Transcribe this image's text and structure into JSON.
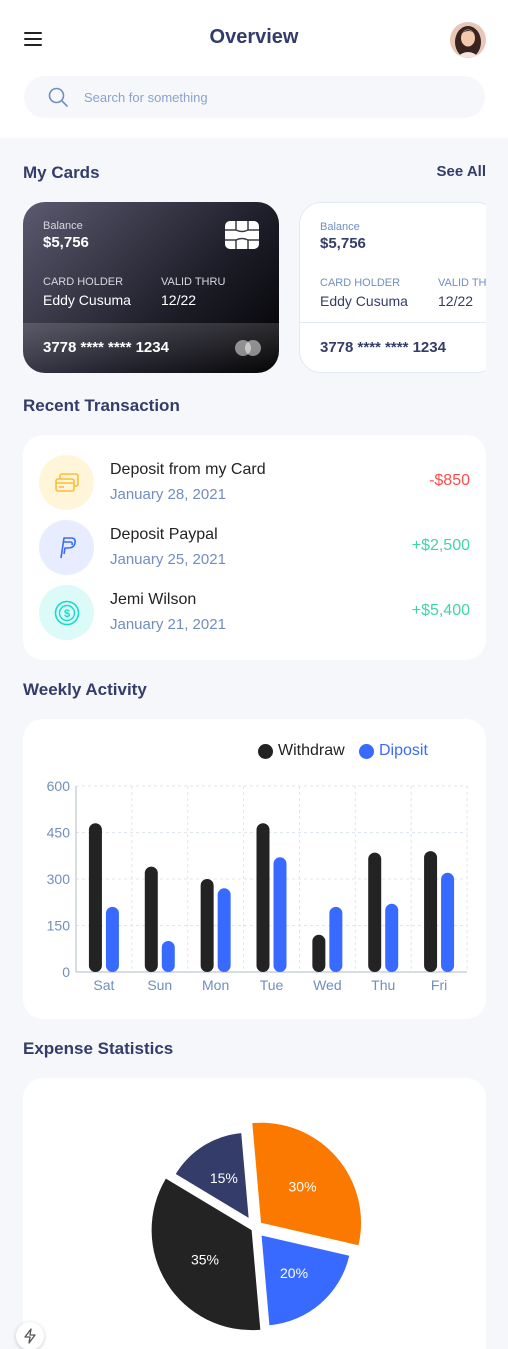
{
  "header": {
    "title": "Overview",
    "search_placeholder": "Search for something"
  },
  "cards_section": {
    "title": "My Cards",
    "see_all": "See All",
    "cards": [
      {
        "theme": "dark",
        "balance_label": "Balance",
        "balance": "$5,756",
        "holder_label": "CARD HOLDER",
        "holder": "Eddy Cusuma",
        "valid_label": "VALID THRU",
        "valid": "12/22",
        "number": "3778 **** **** 1234"
      },
      {
        "theme": "light",
        "balance_label": "Balance",
        "balance": "$5,756",
        "holder_label": "CARD HOLDER",
        "holder": "Eddy Cusuma",
        "valid_label": "VALID THRU",
        "valid": "12/22",
        "number": "3778 **** **** 1234"
      }
    ]
  },
  "transactions": {
    "title": "Recent Transaction",
    "items": [
      {
        "icon": "card-icon",
        "title": "Deposit from my Card",
        "date": "January 28, 2021",
        "amount": "-$850",
        "kind": "neg",
        "icon_bg": "#fff5d9",
        "icon_color": "#ffbb38"
      },
      {
        "icon": "paypal-icon",
        "title": "Deposit Paypal",
        "date": "January 25, 2021",
        "amount": "+$2,500",
        "kind": "pos",
        "icon_bg": "#e7edff",
        "icon_color": "#396aff"
      },
      {
        "icon": "dollar-icon",
        "title": "Jemi Wilson",
        "date": "January 21, 2021",
        "amount": "+$5,400",
        "kind": "pos",
        "icon_bg": "#dcfaf8",
        "icon_color": "#16dbcc"
      }
    ]
  },
  "weekly": {
    "title": "Weekly Activity"
  },
  "expense": {
    "title": "Expense Statistics"
  },
  "colors": {
    "withdraw": "#232323",
    "deposit": "#396aff",
    "orange": "#fc7900",
    "navy": "#343c6a",
    "blue": "#396aff",
    "black": "#232323"
  },
  "chart_data": [
    {
      "type": "bar",
      "categories": [
        "Sat",
        "Sun",
        "Mon",
        "Tue",
        "Wed",
        "Thu",
        "Fri"
      ],
      "series": [
        {
          "name": "Withdraw",
          "values": [
            480,
            340,
            300,
            480,
            120,
            385,
            390
          ]
        },
        {
          "name": "Diposit",
          "values": [
            210,
            100,
            270,
            370,
            210,
            220,
            320
          ]
        }
      ],
      "yticks": [
        0,
        150,
        300,
        450,
        600
      ],
      "ylim": [
        0,
        600
      ],
      "grid": true,
      "legend": "top-right"
    },
    {
      "type": "pie",
      "slices": [
        {
          "label": "30%",
          "value": 30,
          "color": "#fc7900"
        },
        {
          "label": "20%",
          "value": 20,
          "color": "#396aff"
        },
        {
          "label": "35%",
          "value": 35,
          "color": "#232323"
        },
        {
          "label": "15%",
          "value": 15,
          "color": "#343c6a"
        }
      ]
    }
  ]
}
